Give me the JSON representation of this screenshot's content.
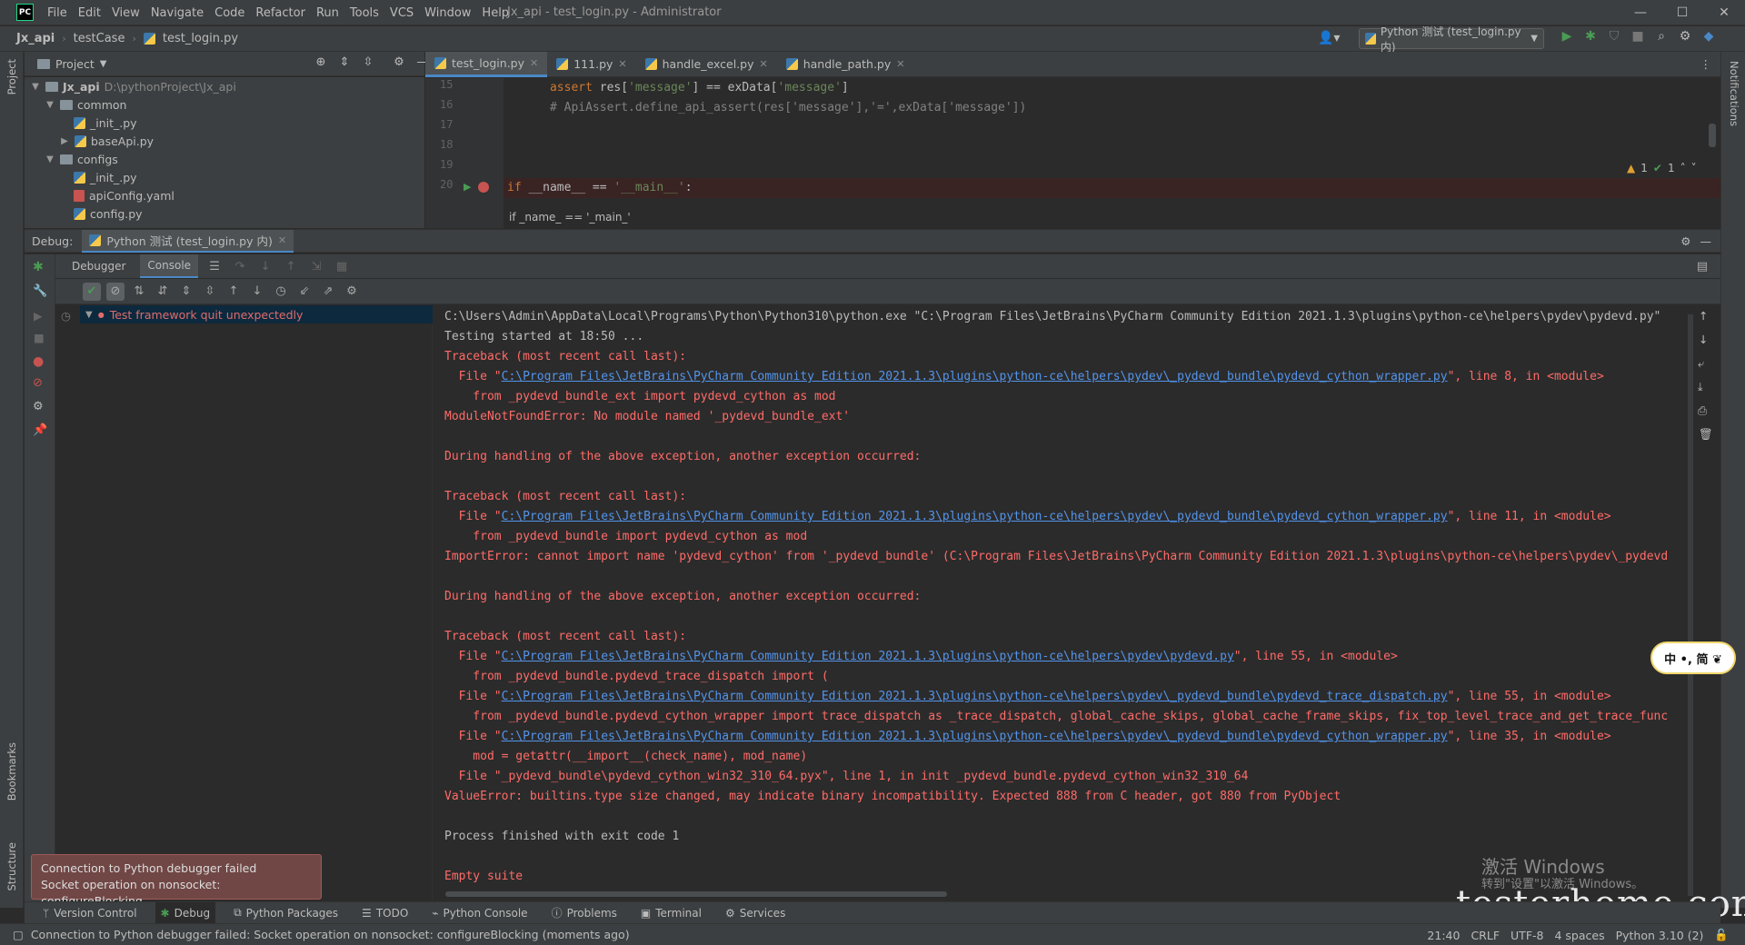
{
  "app": {
    "logo": "PC",
    "title": "Jx_api - test_login.py - Administrator",
    "menu": [
      "File",
      "Edit",
      "View",
      "Navigate",
      "Code",
      "Refactor",
      "Run",
      "Tools",
      "VCS",
      "Window",
      "Help"
    ]
  },
  "navbar": {
    "crumbs": [
      "Jx_api",
      "testCase",
      "test_login.py"
    ],
    "run_config": "Python 测试 (test_login.py 内)"
  },
  "project": {
    "header": "Project",
    "tree": [
      {
        "label": "Jx_api",
        "note": "D:\\pythonProject\\Jx_api",
        "level": 0,
        "kind": "folder",
        "open": true
      },
      {
        "label": "common",
        "level": 1,
        "kind": "folder",
        "open": true
      },
      {
        "label": "_init_.py",
        "level": 2,
        "kind": "py"
      },
      {
        "label": "baseApi.py",
        "level": 2,
        "kind": "py",
        "collapsed": true
      },
      {
        "label": "configs",
        "level": 1,
        "kind": "folder",
        "open": true
      },
      {
        "label": "_init_.py",
        "level": 2,
        "kind": "py"
      },
      {
        "label": "apiConfig.yaml",
        "level": 2,
        "kind": "yaml"
      },
      {
        "label": "config.py",
        "level": 2,
        "kind": "py"
      }
    ]
  },
  "editor": {
    "tabs": [
      "test_login.py",
      "111.py",
      "handle_excel.py",
      "handle_path.py"
    ],
    "active_tab": 0,
    "line_numbers": [
      "15",
      "16",
      "17",
      "18",
      "19",
      "20"
    ],
    "inspection": {
      "warnings": "1",
      "ok": "1"
    },
    "breadcrumb_hint": "if _name_ == '_main_'"
  },
  "debug": {
    "label": "Debug:",
    "session_tab": "Python 测试 (test_login.py 内)",
    "subtabs": [
      "Debugger",
      "Console"
    ],
    "active_subtab": 1,
    "test_item": "Test framework quit unexpectedly",
    "console_lines": [
      {
        "t": "C:\\Users\\Admin\\AppData\\Local\\Programs\\Python\\Python310\\python.exe \"C:\\Program Files\\JetBrains\\PyCharm Community Edition 2021.1.3\\plugins\\python-ce\\helpers\\pydev\\pydevd.py\"",
        "c": "gray"
      },
      {
        "t": "Testing started at 18:50 ...",
        "c": "gray"
      },
      {
        "t": "Traceback (most recent call last):",
        "c": "red"
      },
      {
        "pre": "  File \"",
        "link": "C:\\Program Files\\JetBrains\\PyCharm Community Edition 2021.1.3\\plugins\\python-ce\\helpers\\pydev\\_pydevd_bundle\\pydevd_cython_wrapper.py",
        "post": "\", line 8, in <module>",
        "c": "red"
      },
      {
        "t": "    from _pydevd_bundle_ext import pydevd_cython as mod",
        "c": "red"
      },
      {
        "t": "ModuleNotFoundError: No module named '_pydevd_bundle_ext'",
        "c": "red"
      },
      {
        "t": "",
        "c": "red"
      },
      {
        "t": "During handling of the above exception, another exception occurred:",
        "c": "red"
      },
      {
        "t": "",
        "c": "red"
      },
      {
        "t": "Traceback (most recent call last):",
        "c": "red"
      },
      {
        "pre": "  File \"",
        "link": "C:\\Program Files\\JetBrains\\PyCharm Community Edition 2021.1.3\\plugins\\python-ce\\helpers\\pydev\\_pydevd_bundle\\pydevd_cython_wrapper.py",
        "post": "\", line 11, in <module>",
        "c": "red"
      },
      {
        "t": "    from _pydevd_bundle import pydevd_cython as mod",
        "c": "red"
      },
      {
        "t": "ImportError: cannot import name 'pydevd_cython' from '_pydevd_bundle' (C:\\Program Files\\JetBrains\\PyCharm Community Edition 2021.1.3\\plugins\\python-ce\\helpers\\pydev\\_pydevd",
        "c": "red"
      },
      {
        "t": "",
        "c": "red"
      },
      {
        "t": "During handling of the above exception, another exception occurred:",
        "c": "red"
      },
      {
        "t": "",
        "c": "red"
      },
      {
        "t": "Traceback (most recent call last):",
        "c": "red"
      },
      {
        "pre": "  File \"",
        "link": "C:\\Program Files\\JetBrains\\PyCharm Community Edition 2021.1.3\\plugins\\python-ce\\helpers\\pydev\\pydevd.py",
        "post": "\", line 55, in <module>",
        "c": "red"
      },
      {
        "t": "    from _pydevd_bundle.pydevd_trace_dispatch import (",
        "c": "red"
      },
      {
        "pre": "  File \"",
        "link": "C:\\Program Files\\JetBrains\\PyCharm Community Edition 2021.1.3\\plugins\\python-ce\\helpers\\pydev\\_pydevd_bundle\\pydevd_trace_dispatch.py",
        "post": "\", line 55, in <module>",
        "c": "red"
      },
      {
        "t": "    from _pydevd_bundle.pydevd_cython_wrapper import trace_dispatch as _trace_dispatch, global_cache_skips, global_cache_frame_skips, fix_top_level_trace_and_get_trace_func",
        "c": "red"
      },
      {
        "pre": "  File \"",
        "link": "C:\\Program Files\\JetBrains\\PyCharm Community Edition 2021.1.3\\plugins\\python-ce\\helpers\\pydev\\_pydevd_bundle\\pydevd_cython_wrapper.py",
        "post": "\", line 35, in <module>",
        "c": "red"
      },
      {
        "t": "    mod = getattr(__import__(check_name), mod_name)",
        "c": "red"
      },
      {
        "t": "  File \"_pydevd_bundle\\pydevd_cython_win32_310_64.pyx\", line 1, in init _pydevd_bundle.pydevd_cython_win32_310_64",
        "c": "red"
      },
      {
        "t": "ValueError: builtins.type size changed, may indicate binary incompatibility. Expected 888 from C header, got 880 from PyObject",
        "c": "red"
      },
      {
        "t": "",
        "c": "gray"
      },
      {
        "t": "Process finished with exit code 1",
        "c": "gray"
      },
      {
        "t": "",
        "c": "gray"
      },
      {
        "t": "Empty suite",
        "c": "red"
      }
    ]
  },
  "popup": {
    "line1": "Connection to Python debugger failed",
    "line2": "Socket operation on nonsocket: configureBlocking"
  },
  "bottom_tools": [
    "Version Control",
    "Debug",
    "Python Packages",
    "TODO",
    "Problems",
    "Python Console",
    "Terminal",
    "Services"
  ],
  "status": {
    "message": "Connection to Python debugger failed: Socket operation on nonsocket: configureBlocking (moments ago)",
    "position": "21:40",
    "line_sep": "CRLF",
    "encoding": "UTF-8",
    "indent": "4 spaces",
    "interpreter": "Python 3.10 (2)"
  },
  "side_labels": {
    "project": "Project",
    "bookmarks": "Bookmarks",
    "structure": "Structure",
    "notifications": "Notifications"
  },
  "watermark": {
    "activate_title": "激活 Windows",
    "activate_sub": "转到\"设置\"以激活 Windows。",
    "site": "testerhome.com",
    "badge": "中 •, 简 ❦"
  }
}
